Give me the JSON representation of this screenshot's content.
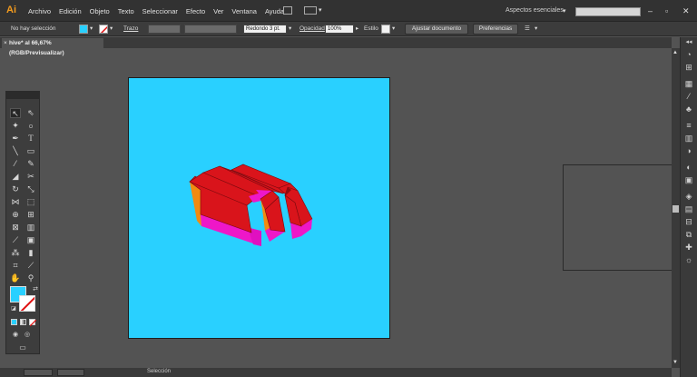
{
  "app": {
    "logo": "Ai"
  },
  "menubar": {
    "items": [
      "Archivo",
      "Edición",
      "Objeto",
      "Texto",
      "Seleccionar",
      "Efecto",
      "Ver",
      "Ventana",
      "Ayuda"
    ],
    "workspace": "Aspectos esenciales",
    "search_placeholder": ""
  },
  "controlbar": {
    "selection": "No hay selección",
    "fill_color": "#29d0ff",
    "stroke_label": "Trazo",
    "brush": "Redondo 3 pt.",
    "opacity_label": "Opacidad",
    "opacity_value": "100%",
    "style_label": "Estilo",
    "fit_document": "Ajustar documento",
    "preferences": "Preferencias"
  },
  "document": {
    "tab_title": "hive* al 66,67% (RGB/Previsualizar)",
    "close": "×"
  },
  "artboard": {
    "background": "#29d0ff"
  },
  "colors": {
    "red": "#d9141b",
    "magenta": "#ee17c8",
    "orange": "#f28a10",
    "dark_red": "#8e0a10"
  },
  "statusbar": {
    "tool": "Selección"
  }
}
